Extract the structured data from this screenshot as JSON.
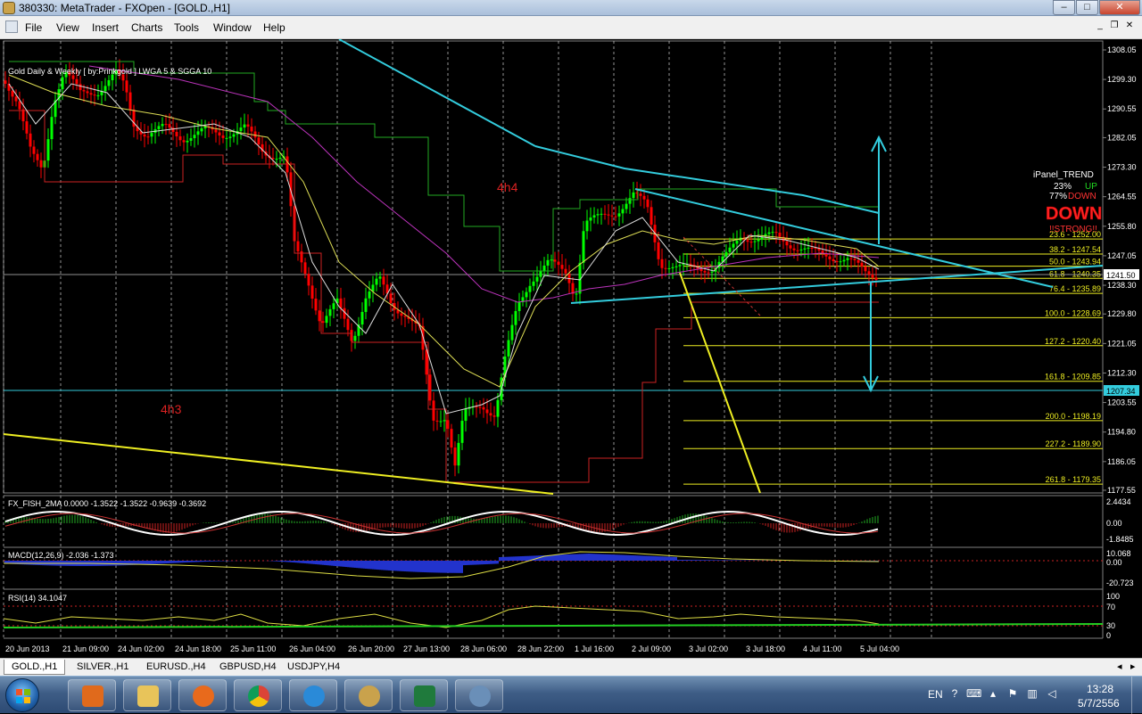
{
  "window": {
    "title": "380330: MetaTrader - FXOpen - [GOLD.,H1]"
  },
  "menu": {
    "items": [
      "File",
      "View",
      "Insert",
      "Charts",
      "Tools",
      "Window",
      "Help"
    ]
  },
  "chart": {
    "info": "Gold Daily & Weekly [ by:Prinkgold ] LWGA 5 & SGGA 10",
    "price_labels": [
      "1308.05",
      "1299.30",
      "1290.55",
      "1282.05",
      "1273.30",
      "1264.55",
      "1255.80",
      "1247.05",
      "1238.30",
      "1229.80",
      "1221.05",
      "1212.30",
      "1203.55",
      "1194.80",
      "1186.05",
      "1177.55"
    ],
    "current_price": "1241.50",
    "hline_price": "1207.34",
    "fib_labels": [
      "23.6 - 1252.00",
      "38.2 - 1247.54",
      "50.0 - 1243.94",
      "61.8 - 1240.35",
      "76.4 - 1235.89",
      "100.0 - 1228.69",
      "127.2 - 1220.40",
      "161.8 - 1209.85",
      "200.0 - 1198.19",
      "227.2 - 1189.90",
      "261.8 - 1179.35"
    ],
    "annotations": [
      "4h4",
      "4h3"
    ],
    "ipanel": {
      "title": "iPanel_TREND",
      "up_pct": "23%",
      "up_label": "UP",
      "down_pct": "77%",
      "down_label": "DOWN",
      "big_label": "DOWN",
      "sub_label": "!!STRONG!!"
    },
    "time_labels": [
      "20 Jun 2013",
      "21 Jun 09:00",
      "24 Jun 02:00",
      "24 Jun 18:00",
      "25 Jun 11:00",
      "26 Jun 04:00",
      "26 Jun 20:00",
      "27 Jun 13:00",
      "28 Jun 06:00",
      "28 Jun 22:00",
      "1 Jul 16:00",
      "2 Jul 09:00",
      "3 Jul 02:00",
      "3 Jul 18:00",
      "4 Jul 11:00",
      "5 Jul 04:00"
    ]
  },
  "fish": {
    "label": "FX_FISH_2MA 0.0000 -1.3522 -1.3522 -0.9639 -0.3692",
    "scale": [
      "2.4434",
      "0.00",
      "-1.8485"
    ]
  },
  "macd": {
    "label": "MACD(12,26,9) -2.036 -1.373",
    "scale": [
      "10.068",
      "0.00",
      "-20.723"
    ]
  },
  "rsi": {
    "label": "RSI(14) 34.1047",
    "scale": [
      "100",
      "70",
      "30",
      "0"
    ]
  },
  "tabs": [
    "GOLD.,H1",
    "SILVER.,H1",
    "EURUSD.,H4",
    "GBPUSD,H4",
    "USDJPY,H4"
  ],
  "taskbar": {
    "lang": "EN",
    "time": "13:28",
    "date": "5/7/2556"
  },
  "colors": {
    "bull": "#00ff00",
    "bear": "#ff0000",
    "trendline": "#33ccdd",
    "yellow": "#ffff00",
    "magenta": "#cc33cc",
    "grid": "#c0c0c0"
  }
}
